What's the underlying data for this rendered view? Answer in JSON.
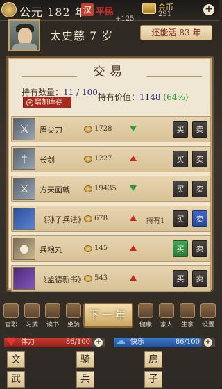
{
  "topbar": {
    "year": "公元 182 年",
    "rank_badge": "汉",
    "rank": "平民",
    "gain": "+125",
    "gold_label": "金币",
    "gold_value": "291",
    "plus": "+"
  },
  "character": {
    "name": "太史慈 7 岁",
    "remaining_life": "还能活 83 年"
  },
  "trade": {
    "title": "交易",
    "holding_label": "持有数量：",
    "holding_value": "11 / 100",
    "add_stock": "增加库存",
    "value_label": "持有价值：",
    "value": "1148",
    "value_pct": "(64%)",
    "buy_label": "买",
    "sell_label": "卖",
    "items": [
      {
        "name": "眉尖刀",
        "price": "1728",
        "trend": "down",
        "held": "",
        "icon": "blade-icon"
      },
      {
        "name": "长剑",
        "price": "1227",
        "trend": "up",
        "held": "",
        "icon": "sword-icon"
      },
      {
        "name": "方天画戟",
        "price": "19435",
        "trend": "down",
        "held": "",
        "icon": "halberd-icon"
      },
      {
        "name": "《孙子兵法》",
        "price": "678",
        "trend": "up",
        "held": "持有1",
        "icon": "blue-book-icon"
      },
      {
        "name": "兵粮丸",
        "price": "145",
        "trend": "up",
        "held": "",
        "icon": "pill-icon"
      },
      {
        "name": "《孟德新书》",
        "price": "543",
        "trend": "up",
        "held": "",
        "icon": "purple-book-icon"
      }
    ]
  },
  "nav": {
    "items": [
      "官职",
      "习武",
      "读书",
      "坐骑"
    ],
    "items_right": [
      "健康",
      "家人",
      "生意",
      "设置"
    ],
    "next_year": "下一年"
  },
  "bars": {
    "stamina_label": "体力",
    "stamina_value": "86/100",
    "stamina_fraction": 0.86,
    "happy_label": "快乐",
    "happy_value": "86/100",
    "happy_fraction": 0.86
  },
  "actions": {
    "wen": "文",
    "qi": "骑",
    "fang": "房",
    "wu": "武",
    "bing": "兵",
    "zi": "子"
  }
}
